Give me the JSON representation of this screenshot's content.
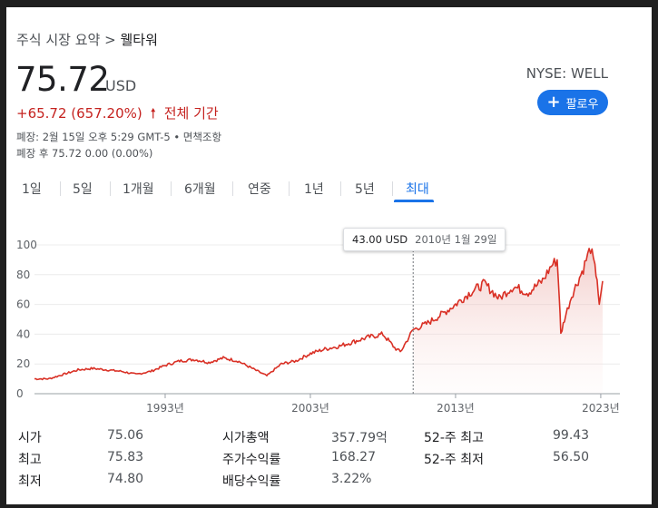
{
  "breadcrumb": {
    "parent": "주식 시장 요약",
    "separator": ">",
    "current": "웰타워"
  },
  "quote": {
    "price": "75.72",
    "currency": "USD",
    "change": "+65.72 (657.20%)",
    "change_arrow": "🠕",
    "change_period": "전체 기간",
    "close_line": "폐장: 2월 15일 오후 5:29 GMT-5 • 면책조항",
    "after_hours_line": "폐장 후 75.72 0.00 (0.00%)",
    "ticker": "NYSE: WELL",
    "follow_label": "팔로우",
    "follow_icon": "plus-icon"
  },
  "range_tabs": [
    {
      "label": "1일",
      "active": false
    },
    {
      "label": "5일",
      "active": false
    },
    {
      "label": "1개월",
      "active": false
    },
    {
      "label": "6개월",
      "active": false
    },
    {
      "label": "연중",
      "active": false
    },
    {
      "label": "1년",
      "active": false
    },
    {
      "label": "5년",
      "active": false
    },
    {
      "label": "최대",
      "active": true
    }
  ],
  "tooltip": {
    "value": "43.00 USD",
    "date": "2010년 1월 29일"
  },
  "chart_data": {
    "type": "area",
    "line_color": "#d93025",
    "x_tick_labels": [
      "1993년",
      "2003년",
      "2013년",
      "2023년"
    ],
    "x_tick_years": [
      1993,
      2003,
      2013,
      2023
    ],
    "y_tick_labels": [
      "0",
      "20",
      "40",
      "60",
      "80",
      "100"
    ],
    "ylim": [
      0,
      100
    ],
    "xlim": [
      1984.0,
      2023.13
    ],
    "series": [
      {
        "x": [
          1984.0,
          1985.0,
          1986.0,
          1987.0,
          1988.0,
          1989.0,
          1990.0,
          1991.0,
          1992.0,
          1993.0,
          1994.0,
          1995.0,
          1996.0,
          1997.0,
          1998.0,
          1999.0,
          2000.0,
          2001.0,
          2002.0,
          2003.0,
          2004.0,
          2005.0,
          2006.0,
          2007.0,
          2008.0,
          2008.8,
          2009.2,
          2010.08,
          2011.0,
          2012.0,
          2013.0,
          2014.0,
          2015.0,
          2016.0,
          2016.7,
          2017.0,
          2018.0,
          2019.0,
          2019.6,
          2020.0,
          2020.15,
          2020.25,
          2020.5,
          2021.0,
          2021.8,
          2022.0,
          2022.3,
          2022.6,
          2022.75,
          2022.9,
          2023.13
        ],
        "y": [
          10,
          10,
          13,
          16,
          17,
          16,
          15,
          13,
          15,
          19,
          22,
          23,
          21,
          24,
          22,
          17,
          12,
          20,
          22,
          27,
          30,
          32,
          35,
          38,
          40,
          31,
          28,
          43,
          47,
          53,
          60,
          68,
          74,
          64,
          70,
          72,
          68,
          76,
          86,
          90,
          65,
          40,
          50,
          66,
          84,
          90,
          98,
          84,
          78,
          58,
          75.72
        ]
      }
    ]
  },
  "stats": {
    "col1": [
      {
        "label": "시가",
        "value": "75.06"
      },
      {
        "label": "최고",
        "value": "75.83"
      },
      {
        "label": "최저",
        "value": "74.80"
      }
    ],
    "col2": [
      {
        "label": "시가총액",
        "value": "357.79억"
      },
      {
        "label": "주가수익률",
        "value": "168.27"
      },
      {
        "label": "배당수익률",
        "value": "3.22%"
      }
    ],
    "col3": [
      {
        "label": "52-주 최고",
        "value": "99.43"
      },
      {
        "label": "52-주 최저",
        "value": "56.50"
      }
    ]
  }
}
